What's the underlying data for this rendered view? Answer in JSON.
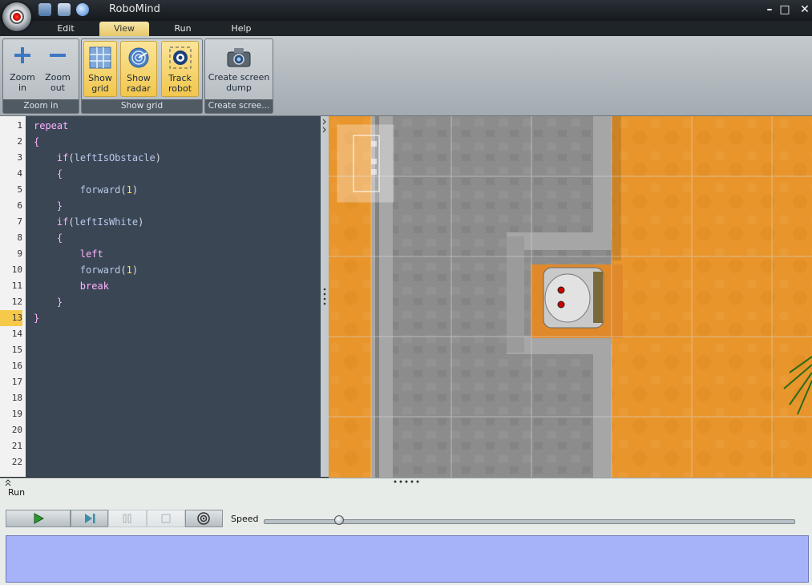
{
  "window": {
    "title": "RoboMind",
    "controls": {
      "minimize": "–",
      "maximize": "□",
      "close": "✕"
    }
  },
  "menu_tabs": [
    {
      "label": "Edit",
      "active": false
    },
    {
      "label": "View",
      "active": true
    },
    {
      "label": "Run",
      "active": false
    },
    {
      "label": "Help",
      "active": false
    }
  ],
  "ribbon": {
    "groups": [
      {
        "label": "Zoom in"
      },
      {
        "label": "Show grid"
      },
      {
        "label": "Create scree..."
      }
    ],
    "buttons": [
      {
        "label": "Zoom\nin",
        "icon": "plus-icon",
        "active": false
      },
      {
        "label": "Zoom\nout",
        "icon": "minus-icon",
        "active": false
      },
      {
        "label": "Show\ngrid",
        "icon": "grid-icon",
        "active": true
      },
      {
        "label": "Show\nradar",
        "icon": "radar-icon",
        "active": true
      },
      {
        "label": "Track\nrobot",
        "icon": "track-icon",
        "active": true
      },
      {
        "label": "Create screen\ndump",
        "icon": "camera-icon",
        "active": false
      }
    ]
  },
  "editor": {
    "current_line": 13,
    "line_numbers": [
      "1",
      "2",
      "3",
      "4",
      "5",
      "6",
      "7",
      "8",
      "9",
      "10",
      "11",
      "12",
      "13",
      "14",
      "15",
      "16",
      "17",
      "18",
      "19",
      "20",
      "21",
      "22"
    ],
    "lines": [
      "repeat",
      "{",
      "    if(leftIsObstacle)",
      "    {",
      "        forward(1)",
      "    }",
      "    if(leftIsWhite)",
      "    {",
      "        left",
      "        forward(1)",
      "        break",
      "    }",
      "}"
    ]
  },
  "run_panel": {
    "title": "Run",
    "speed_label": "Speed",
    "speed_value": 0.14,
    "buttons": [
      "play-icon",
      "step-icon",
      "pause-icon",
      "stop-icon",
      "radar-target-icon"
    ]
  },
  "colors": {
    "editor_bg": "#3a4654",
    "keyword": "#ffb3ff",
    "function": "#b9c9e8",
    "number": "#f2e06a",
    "active_tab": "#f1c64d",
    "output_bg": "#a7b3f9",
    "sand": "#e8962c"
  }
}
